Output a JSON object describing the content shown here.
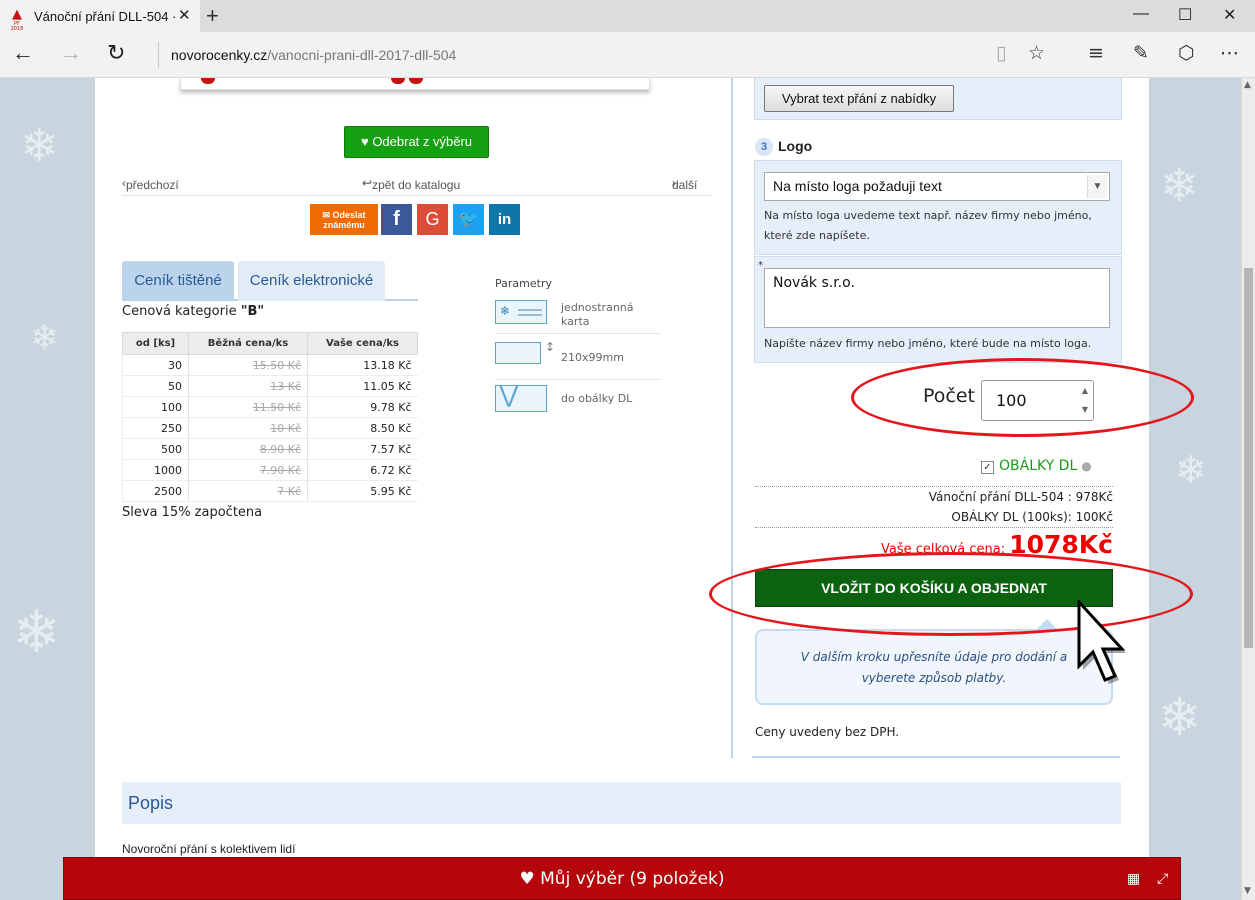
{
  "browser": {
    "tab_title": "Vánoční přání DLL-504 ·",
    "favicon_label": "PF 2018",
    "tab_close": "✕",
    "new_tab": "+",
    "url_host": "novorocenky.cz",
    "url_path": "/vanocni-prani-dll-2017-dll-504"
  },
  "product": {
    "remove_label": "Odebrat z výběru",
    "prev_label": "předchozí",
    "catalog_label": "zpět do katalogu",
    "next_label": "další",
    "share_mail_line1": "Odeslat",
    "share_mail_line2": "známému",
    "share_fb": "f",
    "share_gp": "G",
    "share_tw": "🐦",
    "share_li": "in"
  },
  "pricing": {
    "tab_printed": "Ceník tištěné",
    "tab_electronic": "Ceník elektronické",
    "category_label": "Cenová kategorie ",
    "category_value": "\"B\"",
    "headers": [
      "od [ks]",
      "Běžná cena/ks",
      "Vaše cena/ks"
    ],
    "rows": [
      [
        "30",
        "15.50 Kč",
        "13.18 Kč"
      ],
      [
        "50",
        "13 Kč",
        "11.05 Kč"
      ],
      [
        "100",
        "11.50 Kč",
        "9.78 Kč"
      ],
      [
        "250",
        "10 Kč",
        "8.50 Kč"
      ],
      [
        "500",
        "8.90 Kč",
        "7.57 Kč"
      ],
      [
        "1000",
        "7.90 Kč",
        "6.72 Kč"
      ],
      [
        "2500",
        "7 Kč",
        "5.95 Kč"
      ]
    ],
    "discount": "Sleva 15% započtena"
  },
  "params": {
    "title": "Parametry",
    "items": [
      "jednostranná karta",
      "210x99mm",
      "do obálky DL"
    ]
  },
  "order": {
    "pick_text_label": "Vybrat text přání z nabídky",
    "logo_step": "3",
    "logo_title": "Logo",
    "logo_select": "Na místo loga požaduji text",
    "logo_hint_1": "Na místo loga uvedeme text např. název firmy nebo jméno,",
    "logo_hint_2": "které zde napíšete.",
    "company_value": "Novák s.r.o.",
    "company_hint": "Napište název firmy nebo jméno, které bude na místo loga.",
    "required_mark": "*",
    "count_label": "Počet :",
    "count_value": "100",
    "envelopes_label": "OBÁLKY DL",
    "line_card": "Vánoční přání DLL-504 : 978Kč",
    "line_envelopes": "OBÁLKY DL (100ks): 100Kč",
    "total_label": "Vaše celková cena: ",
    "total_value": "1078Kč",
    "submit_label": "VLOŽIT DO KOŠÍKU A OBJEDNAT",
    "next_step_1": "V dalším kroku upřesníte údaje pro dodání a",
    "next_step_2": "vyberete způsob platby.",
    "vat_note": "Ceny uvedeny bez DPH."
  },
  "description": {
    "heading": "Popis",
    "text": "Novoroční přání s kolektivem lidí"
  },
  "selection_bar": {
    "label": "Můj výběr (9 položek)"
  },
  "colors": {
    "brand_red": "#b5060b",
    "order_green": "#0b6310",
    "remove_green": "#16a113",
    "highlight_red": "#e4161c",
    "tab_blue": "#bcd3ec"
  }
}
